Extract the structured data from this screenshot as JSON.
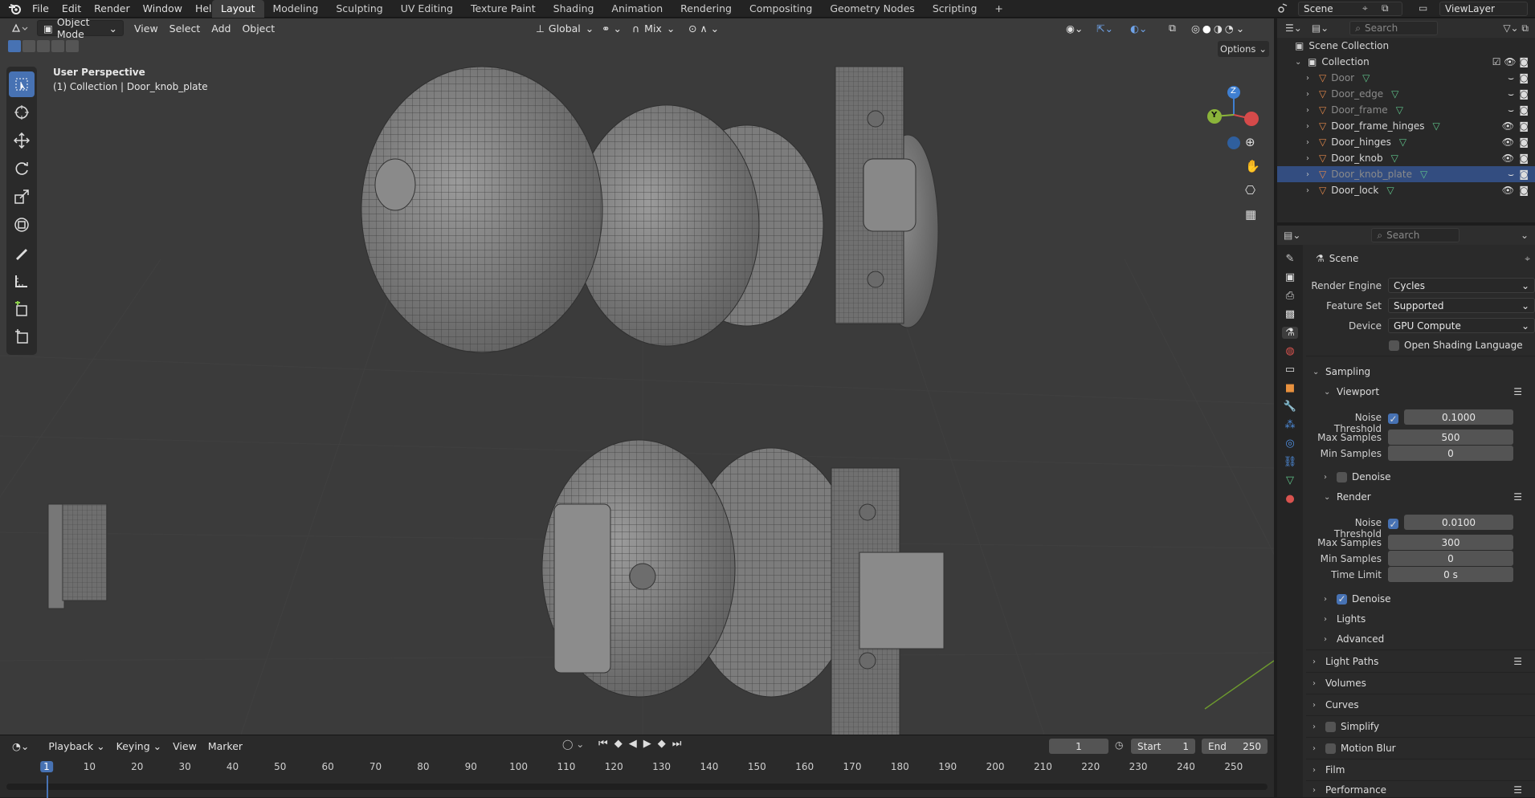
{
  "menu": {
    "items": [
      "File",
      "Edit",
      "Render",
      "Window",
      "Help"
    ]
  },
  "workspaces": {
    "tabs": [
      "Layout",
      "Modeling",
      "Sculpting",
      "UV Editing",
      "Texture Paint",
      "Shading",
      "Animation",
      "Rendering",
      "Compositing",
      "Geometry Nodes",
      "Scripting"
    ],
    "active": "Layout",
    "add_icon": "+"
  },
  "top_right": {
    "scene_label": "Scene",
    "view_layer_label": "ViewLayer"
  },
  "viewport": {
    "mode": "Object Mode",
    "menus": [
      "View",
      "Select",
      "Add",
      "Object"
    ],
    "orientation": "Global",
    "snap_mix": "Mix",
    "options_label": "Options",
    "overlay_line1": "User Perspective",
    "overlay_line2": "(1) Collection | Door_knob_plate",
    "axis_x": "X",
    "axis_y": "Y",
    "axis_z": "Z"
  },
  "timeline": {
    "menus": [
      "Playback",
      "Keying",
      "View",
      "Marker"
    ],
    "current_frame": "1",
    "start_label": "Start",
    "start_value": "1",
    "end_label": "End",
    "end_value": "250",
    "ticks": [
      "1",
      "10",
      "20",
      "30",
      "40",
      "50",
      "60",
      "70",
      "80",
      "90",
      "100",
      "110",
      "120",
      "130",
      "140",
      "150",
      "160",
      "170",
      "180",
      "190",
      "200",
      "210",
      "220",
      "230",
      "240",
      "250"
    ]
  },
  "outliner": {
    "search_placeholder": "Search",
    "scene_collection": "Scene Collection",
    "collection": "Collection",
    "objects": [
      {
        "name": "Door",
        "visible": false,
        "selected": false
      },
      {
        "name": "Door_edge",
        "visible": false,
        "selected": false
      },
      {
        "name": "Door_frame",
        "visible": false,
        "selected": false
      },
      {
        "name": "Door_frame_hinges",
        "visible": true,
        "selected": false
      },
      {
        "name": "Door_hinges",
        "visible": true,
        "selected": false
      },
      {
        "name": "Door_knob",
        "visible": true,
        "selected": false
      },
      {
        "name": "Door_knob_plate",
        "visible": false,
        "selected": true
      },
      {
        "name": "Door_lock",
        "visible": true,
        "selected": false
      }
    ]
  },
  "properties": {
    "search_placeholder": "Search",
    "context_title": "Scene",
    "render_engine_label": "Render Engine",
    "render_engine_value": "Cycles",
    "feature_set_label": "Feature Set",
    "feature_set_value": "Supported",
    "device_label": "Device",
    "device_value": "GPU Compute",
    "osl_label": "Open Shading Language",
    "sampling_label": "Sampling",
    "viewport_label": "Viewport",
    "noise_threshold_label": "Noise Threshold",
    "viewport_noise_threshold": "0.1000",
    "max_samples_label": "Max Samples",
    "viewport_max_samples": "500",
    "min_samples_label": "Min Samples",
    "viewport_min_samples": "0",
    "denoise_label": "Denoise",
    "render_label": "Render",
    "render_noise_threshold": "0.0100",
    "render_max_samples": "300",
    "render_min_samples": "0",
    "time_limit_label": "Time Limit",
    "time_limit_value": "0 s",
    "lights_label": "Lights",
    "advanced_label": "Advanced",
    "light_paths_label": "Light Paths",
    "volumes_label": "Volumes",
    "curves_label": "Curves",
    "simplify_label": "Simplify",
    "motion_blur_label": "Motion Blur",
    "film_label": "Film",
    "performance_label": "Performance"
  },
  "colors": {
    "accent": "#4772b3",
    "selection_row": "#334d80",
    "viewport_bg": "#3b3b3b",
    "mesh_orange": "#e0874a",
    "x_axis": "#d54a4a",
    "y_axis": "#8bb43a",
    "z_axis": "#3f7fd1"
  }
}
